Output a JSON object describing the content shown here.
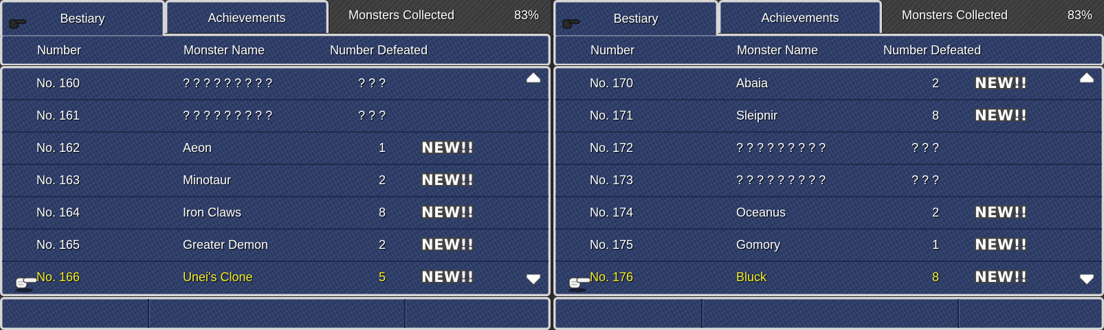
{
  "panels": [
    {
      "tabs": {
        "bestiary": "Bestiary",
        "achievements": "Achievements"
      },
      "collected": {
        "label": "Monsters Collected",
        "percent": "83%"
      },
      "headers": {
        "number": "Number",
        "name": "Monster Name",
        "defeated": "Number Defeated"
      },
      "rows": [
        {
          "number": "No. 160",
          "name": "? ? ? ? ? ? ? ? ?",
          "defeated": "? ? ?",
          "badge": ""
        },
        {
          "number": "No. 161",
          "name": "? ? ? ? ? ? ? ? ?",
          "defeated": "? ? ?",
          "badge": ""
        },
        {
          "number": "No. 162",
          "name": "Aeon",
          "defeated": "1",
          "badge": "NEW!!"
        },
        {
          "number": "No. 163",
          "name": "Minotaur",
          "defeated": "2",
          "badge": "NEW!!"
        },
        {
          "number": "No. 164",
          "name": "Iron Claws",
          "defeated": "8",
          "badge": "NEW!!"
        },
        {
          "number": "No. 165",
          "name": "Greater Demon",
          "defeated": "2",
          "badge": "NEW!!"
        },
        {
          "number": "No. 166",
          "name": "Unei's Clone",
          "defeated": "5",
          "badge": "NEW!!"
        }
      ],
      "selected_index": 6
    },
    {
      "tabs": {
        "bestiary": "Bestiary",
        "achievements": "Achievements"
      },
      "collected": {
        "label": "Monsters Collected",
        "percent": "83%"
      },
      "headers": {
        "number": "Number",
        "name": "Monster Name",
        "defeated": "Number Defeated"
      },
      "rows": [
        {
          "number": "No. 170",
          "name": "Abaia",
          "defeated": "2",
          "badge": "NEW!!"
        },
        {
          "number": "No. 171",
          "name": "Sleipnir",
          "defeated": "8",
          "badge": "NEW!!"
        },
        {
          "number": "No. 172",
          "name": "? ? ? ? ? ? ? ? ?",
          "defeated": "? ? ?",
          "badge": ""
        },
        {
          "number": "No. 173",
          "name": "? ? ? ? ? ? ? ? ?",
          "defeated": "? ? ?",
          "badge": ""
        },
        {
          "number": "No. 174",
          "name": "Oceanus",
          "defeated": "2",
          "badge": "NEW!!"
        },
        {
          "number": "No. 175",
          "name": "Gomory",
          "defeated": "1",
          "badge": "NEW!!"
        },
        {
          "number": "No. 176",
          "name": "Bluck",
          "defeated": "8",
          "badge": "NEW!!"
        }
      ],
      "selected_index": 6
    }
  ],
  "colors": {
    "window_blue": "#2c3d69",
    "selected_text": "#f4ee2a",
    "border": "#d7d7d7"
  },
  "icons": {
    "cursor": "pointing-hand-icon",
    "scroll_up": "triangle-up-icon",
    "scroll_down": "triangle-down-icon"
  }
}
